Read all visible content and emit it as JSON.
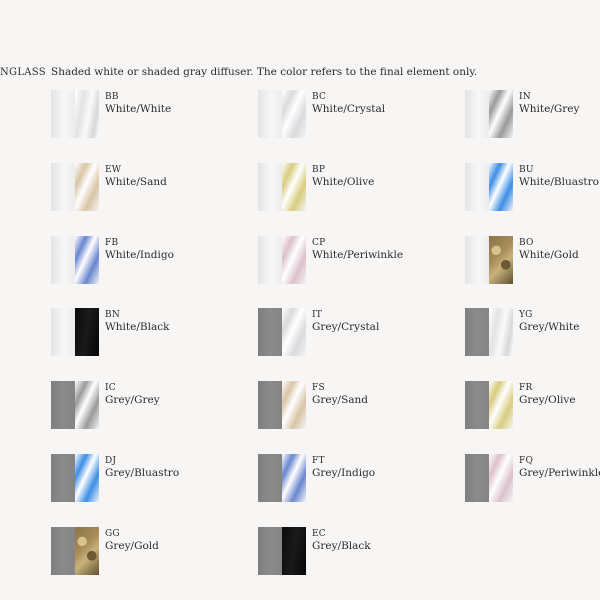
{
  "section": {
    "label": "NGLASS",
    "description": "Shaded white or shaded gray diffuser. The color refers to the final element only."
  },
  "colors": {
    "white_diffuser": "#ededec",
    "grey_diffuser": "#8b8a89",
    "white": "#f2f2f2",
    "crystal": "#d9dadc",
    "grey": "#9a9a9a",
    "sand": "#d9c4a6",
    "olive": "#d8cc7e",
    "bluastro": "#3c8ee6",
    "indigo": "#6a86cf",
    "periwinkle": "#dcc0cc",
    "gold": "#a88c5a",
    "black": "#121212"
  },
  "swatches": [
    {
      "code": "BB",
      "name": "White/White",
      "base": "white_diffuser",
      "finish": "white"
    },
    {
      "code": "BC",
      "name": "White/Crystal",
      "base": "white_diffuser",
      "finish": "crystal"
    },
    {
      "code": "IN",
      "name": "White/Grey",
      "base": "white_diffuser",
      "finish": "grey"
    },
    {
      "code": "EW",
      "name": "White/Sand",
      "base": "white_diffuser",
      "finish": "sand"
    },
    {
      "code": "BP",
      "name": "White/Olive",
      "base": "white_diffuser",
      "finish": "olive"
    },
    {
      "code": "BU",
      "name": "White/Bluastro",
      "base": "white_diffuser",
      "finish": "bluastro"
    },
    {
      "code": "FB",
      "name": "White/Indigo",
      "base": "white_diffuser",
      "finish": "indigo"
    },
    {
      "code": "CP",
      "name": "White/Periwinkle",
      "base": "white_diffuser",
      "finish": "periwinkle"
    },
    {
      "code": "BO",
      "name": "White/Gold",
      "base": "white_diffuser",
      "finish": "gold"
    },
    {
      "code": "BN",
      "name": "White/Black",
      "base": "white_diffuser",
      "finish": "black"
    },
    {
      "code": "IT",
      "name": "Grey/Crystal",
      "base": "grey_diffuser",
      "finish": "crystal"
    },
    {
      "code": "YG",
      "name": "Grey/White",
      "base": "grey_diffuser",
      "finish": "white"
    },
    {
      "code": "IC",
      "name": "Grey/Grey",
      "base": "grey_diffuser",
      "finish": "grey"
    },
    {
      "code": "FS",
      "name": "Grey/Sand",
      "base": "grey_diffuser",
      "finish": "sand"
    },
    {
      "code": "FR",
      "name": "Grey/Olive",
      "base": "grey_diffuser",
      "finish": "olive"
    },
    {
      "code": "DJ",
      "name": "Grey/Bluastro",
      "base": "grey_diffuser",
      "finish": "bluastro"
    },
    {
      "code": "FT",
      "name": "Grey/Indigo",
      "base": "grey_diffuser",
      "finish": "indigo"
    },
    {
      "code": "FQ",
      "name": "Grey/Periwinkle",
      "base": "grey_diffuser",
      "finish": "periwinkle"
    },
    {
      "code": "GG",
      "name": "Grey/Gold",
      "base": "grey_diffuser",
      "finish": "gold"
    },
    {
      "code": "EC",
      "name": "Grey/Black",
      "base": "grey_diffuser",
      "finish": "black"
    }
  ]
}
